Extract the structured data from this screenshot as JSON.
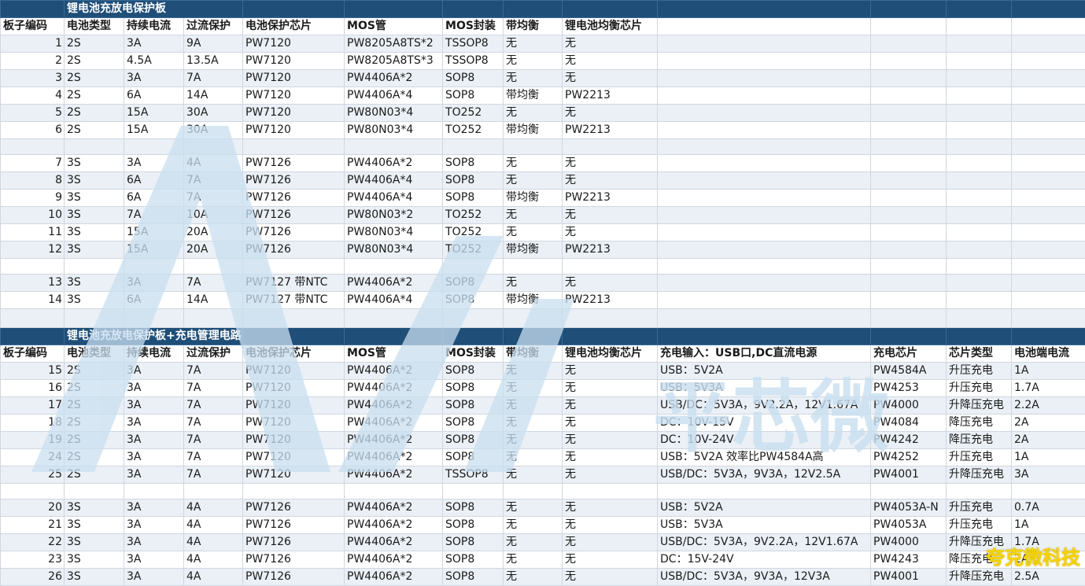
{
  "section1": {
    "title": "锂电池充放电保护板",
    "headers": [
      "板子编码",
      "电池类型",
      "持续电流",
      "过流保护",
      "电池保护芯片",
      "MOS管",
      "MOS封装",
      "带均衡",
      "锂电池均衡芯片"
    ],
    "groups": [
      [
        [
          "1",
          "2S",
          "3A",
          "9A",
          "PW7120",
          "PW8205A8TS*2",
          "TSSOP8",
          "无",
          "无"
        ],
        [
          "2",
          "2S",
          "4.5A",
          "13.5A",
          "PW7120",
          "PW8205A8TS*3",
          "TSSOP8",
          "无",
          "无"
        ],
        [
          "3",
          "2S",
          "3A",
          "7A",
          "PW7120",
          "PW4406A*2",
          "SOP8",
          "无",
          "无"
        ],
        [
          "4",
          "2S",
          "6A",
          "14A",
          "PW7120",
          "PW4406A*4",
          "SOP8",
          "带均衡",
          "PW2213"
        ],
        [
          "5",
          "2S",
          "15A",
          "30A",
          "PW7120",
          "PW80N03*4",
          "TO252",
          "无",
          "无"
        ],
        [
          "6",
          "2S",
          "15A",
          "30A",
          "PW7120",
          "PW80N03*4",
          "TO252",
          "带均衡",
          "PW2213"
        ]
      ],
      [
        [
          "7",
          "3S",
          "3A",
          "4A",
          "PW7126",
          "PW4406A*2",
          "SOP8",
          "无",
          "无"
        ],
        [
          "8",
          "3S",
          "6A",
          "7A",
          "PW7126",
          "PW4406A*4",
          "SOP8",
          "无",
          "无"
        ],
        [
          "9",
          "3S",
          "6A",
          "7A",
          "PW7126",
          "PW4406A*4",
          "SOP8",
          "带均衡",
          "PW2213"
        ],
        [
          "10",
          "3S",
          "7A",
          "10A",
          "PW7126",
          "PW80N03*2",
          "TO252",
          "无",
          "无"
        ],
        [
          "11",
          "3S",
          "15A",
          "20A",
          "PW7126",
          "PW80N03*4",
          "TO252",
          "无",
          "无"
        ],
        [
          "12",
          "3S",
          "15A",
          "20A",
          "PW7126",
          "PW80N03*4",
          "TO252",
          "带均衡",
          "PW2213"
        ]
      ],
      [
        [
          "13",
          "3S",
          "3A",
          "7A",
          "PW7127 带NTC",
          "PW4406A*2",
          "SOP8",
          "无",
          "无"
        ],
        [
          "14",
          "3S",
          "6A",
          "14A",
          "PW7127 带NTC",
          "PW4406A*4",
          "SOP8",
          "带均衡",
          "PW2213"
        ]
      ]
    ]
  },
  "section2": {
    "title": "锂电池充放电保护板+充电管理电路",
    "headers": [
      "板子编码",
      "电池类型",
      "持续电流",
      "过流保护",
      "电池保护芯片",
      "MOS管",
      "MOS封装",
      "带均衡",
      "锂电池均衡芯片",
      "充电输入：USB口,DC直流电源",
      "充电芯片",
      "芯片类型",
      "电池端电流"
    ],
    "groups": [
      [
        [
          "15",
          "2S",
          "3A",
          "7A",
          "PW7120",
          "PW4406A*2",
          "SOP8",
          "无",
          "无",
          "USB：5V2A",
          "PW4584A",
          "升压充电",
          "1A"
        ],
        [
          "16",
          "2S",
          "3A",
          "7A",
          "PW7120",
          "PW4406A*2",
          "SOP8",
          "无",
          "无",
          "USB：5V3A",
          "PW4253",
          "升压充电",
          "1.7A"
        ],
        [
          "17",
          "2S",
          "3A",
          "7A",
          "PW7120",
          "PW4406A*2",
          "SOP8",
          "无",
          "无",
          "USB/DC：5V3A，9V2.2A，12V1.67A",
          "PW4000",
          "升降压充电",
          "2.2A"
        ],
        [
          "18",
          "2S",
          "3A",
          "7A",
          "PW7120",
          "PW4406A*2",
          "SOP8",
          "无",
          "无",
          "DC：10V-15V",
          "PW4084",
          "降压充电",
          "2A"
        ],
        [
          "19",
          "2S",
          "3A",
          "7A",
          "PW7120",
          "PW4406A*2",
          "SOP8",
          "无",
          "无",
          "DC：10V-24V",
          "PW4242",
          "降压充电",
          "2A"
        ],
        [
          "24",
          "2S",
          "3A",
          "7A",
          "PW7120",
          "PW4406A*2",
          "SOP8",
          "无",
          "无",
          "USB：5V2A 效率比PW4584A高",
          "PW4252",
          "升压充电",
          "1A"
        ],
        [
          "25",
          "2S",
          "3A",
          "7A",
          "PW7120",
          "PW4406A*2",
          "TSSOP8",
          "无",
          "无",
          "USB/DC：5V3A，9V3A，12V2.5A",
          "PW4001",
          "升降压充电",
          "3A"
        ]
      ],
      [
        [
          "20",
          "3S",
          "3A",
          "4A",
          "PW7126",
          "PW4406A*2",
          "SOP8",
          "无",
          "无",
          "USB：5V2A",
          "PW4053A-N",
          "升压充电",
          "0.7A"
        ],
        [
          "21",
          "3S",
          "3A",
          "4A",
          "PW7126",
          "PW4406A*2",
          "SOP8",
          "无",
          "无",
          "USB：5V3A",
          "PW4053A",
          "升压充电",
          "1A"
        ],
        [
          "22",
          "3S",
          "3A",
          "4A",
          "PW7126",
          "PW4406A*2",
          "SOP8",
          "无",
          "无",
          "USB/DC：5V3A，9V2.2A，12V1.67A",
          "PW4000",
          "升降压充电",
          "1.7A"
        ],
        [
          "23",
          "3S",
          "3A",
          "4A",
          "PW7126",
          "PW4406A*2",
          "SOP8",
          "无",
          "无",
          "DC：15V-24V",
          "PW4243",
          "降压充电",
          "2A"
        ],
        [
          "26",
          "3S",
          "3A",
          "4A",
          "PW7126",
          "PW4406A*2",
          "SOP8",
          "无",
          "无",
          "USB/DC：5V3A，9V3A，12V3A",
          "PW4001",
          "升降压充电",
          "2.5A"
        ]
      ]
    ]
  },
  "watermark": {
    "text": "平芯微",
    "color": "#b9d5ec"
  },
  "brand": {
    "text": "夸克微科技",
    "color": "#f5d300"
  },
  "colors": {
    "title_bg": "#1f4e78",
    "band": "#eaf0f6",
    "grid": "#d0d7df"
  }
}
